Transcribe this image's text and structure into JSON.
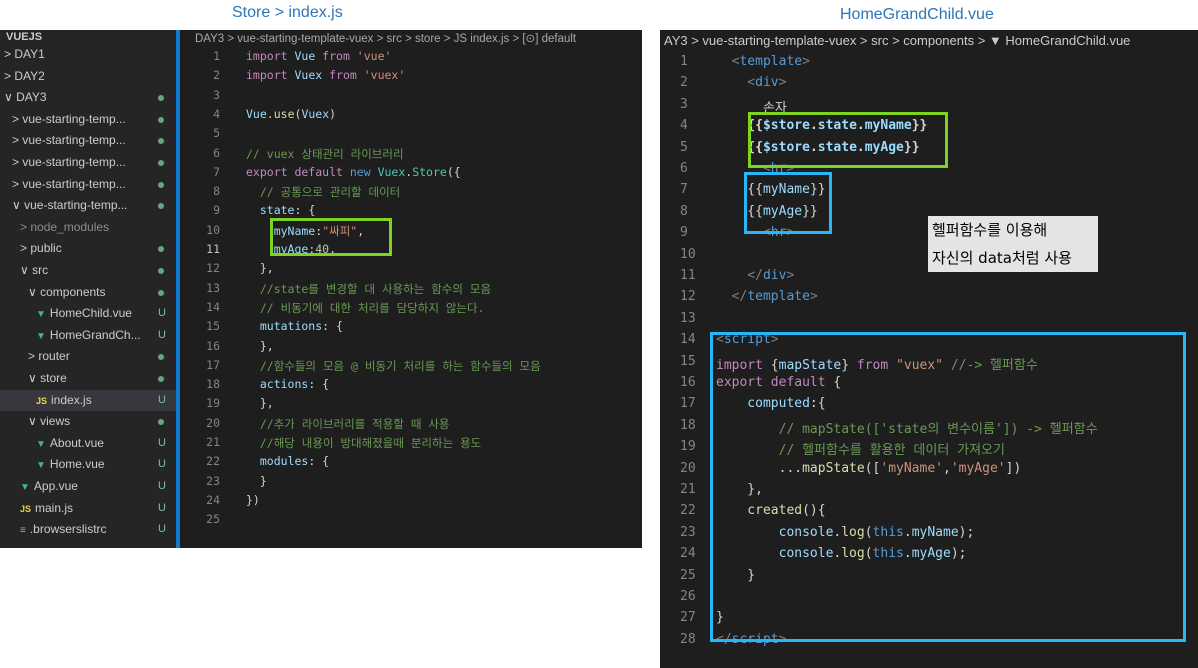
{
  "captions": {
    "left": "Store > index.js",
    "right": "HomeGrandChild.vue"
  },
  "left": {
    "explorer": {
      "root": "VUEJS",
      "items": [
        {
          "label": "DAY1",
          "chev": ">",
          "indent": 0,
          "status": ""
        },
        {
          "label": "DAY2",
          "chev": ">",
          "indent": 0,
          "status": ""
        },
        {
          "label": "DAY3",
          "chev": "∨",
          "indent": 0,
          "status": "dot"
        },
        {
          "label": "vue-starting-temp...",
          "chev": ">",
          "indent": 1,
          "status": "dot"
        },
        {
          "label": "vue-starting-temp...",
          "chev": ">",
          "indent": 1,
          "status": "dot"
        },
        {
          "label": "vue-starting-temp...",
          "chev": ">",
          "indent": 1,
          "status": "dot"
        },
        {
          "label": "vue-starting-temp...",
          "chev": ">",
          "indent": 1,
          "status": "dot"
        },
        {
          "label": "vue-starting-temp...",
          "chev": "∨",
          "indent": 1,
          "status": "dot"
        },
        {
          "label": "node_modules",
          "chev": ">",
          "indent": 2,
          "status": "",
          "muted": true
        },
        {
          "label": "public",
          "chev": ">",
          "indent": 2,
          "status": "dot"
        },
        {
          "label": "src",
          "chev": "∨",
          "indent": 2,
          "status": "dot"
        },
        {
          "label": "components",
          "chev": "∨",
          "indent": 3,
          "status": "dot"
        },
        {
          "label": "HomeChild.vue",
          "icon": "vue",
          "indent": 4,
          "status": "U"
        },
        {
          "label": "HomeGrandCh...",
          "icon": "vue",
          "indent": 4,
          "status": "U"
        },
        {
          "label": "router",
          "chev": ">",
          "indent": 3,
          "status": "dot"
        },
        {
          "label": "store",
          "chev": "∨",
          "indent": 3,
          "status": "dot"
        },
        {
          "label": "index.js",
          "icon": "js",
          "indent": 4,
          "status": "U",
          "selected": true
        },
        {
          "label": "views",
          "chev": "∨",
          "indent": 3,
          "status": "dot"
        },
        {
          "label": "About.vue",
          "icon": "vue",
          "indent": 4,
          "status": "U"
        },
        {
          "label": "Home.vue",
          "icon": "vue",
          "indent": 4,
          "status": "U"
        },
        {
          "label": "App.vue",
          "icon": "vue",
          "indent": 2,
          "status": "U"
        },
        {
          "label": "main.js",
          "icon": "js",
          "indent": 2,
          "status": "U"
        },
        {
          "label": ".browserslistrc",
          "icon": "git",
          "indent": 2,
          "status": "U"
        }
      ]
    },
    "breadcrumb": "DAY3 > vue-starting-template-vuex > src > store > JS index.js > [⊙] default",
    "lines": [
      [
        [
          "k-kw",
          "import "
        ],
        [
          "k-var",
          "Vue"
        ],
        [
          "k-kw",
          " from "
        ],
        [
          "k-str",
          "'vue'"
        ]
      ],
      [
        [
          "k-kw",
          "import "
        ],
        [
          "k-var",
          "Vuex"
        ],
        [
          "k-kw",
          " from "
        ],
        [
          "k-str",
          "'vuex'"
        ]
      ],
      [],
      [
        [
          "k-var",
          "Vue"
        ],
        [
          "k-txt",
          "."
        ],
        [
          "k-fn",
          "use"
        ],
        [
          "k-txt",
          "("
        ],
        [
          "k-var",
          "Vuex"
        ],
        [
          "k-txt",
          ")"
        ]
      ],
      [],
      [
        [
          "k-cmt",
          "// vuex 상태관리 라이브러리"
        ]
      ],
      [
        [
          "k-kw",
          "export default "
        ],
        [
          "k-blue",
          "new "
        ],
        [
          "k-cls",
          "Vuex"
        ],
        [
          "k-txt",
          "."
        ],
        [
          "k-cls",
          "Store"
        ],
        [
          "k-txt",
          "({"
        ]
      ],
      [
        [
          "k-cmt",
          "  // 공통으로 관리할 데이터"
        ]
      ],
      [
        [
          "k-var",
          "  state"
        ],
        [
          "k-txt",
          ": {"
        ]
      ],
      [
        [
          "k-var",
          "    myName"
        ],
        [
          "k-txt",
          ":"
        ],
        [
          "k-str",
          "\"싸피\""
        ],
        [
          "k-txt",
          ","
        ]
      ],
      [
        [
          "k-var",
          "    myAge"
        ],
        [
          "k-txt",
          ":"
        ],
        [
          "k-num",
          "40"
        ],
        [
          "k-txt",
          ","
        ]
      ],
      [
        [
          "k-txt",
          "  },"
        ]
      ],
      [
        [
          "k-cmt",
          "  //state를 변경할 대 사용하는 함수의 모음"
        ]
      ],
      [
        [
          "k-cmt",
          "  // 비동기에 대한 처리를 담당하지 않는다."
        ]
      ],
      [
        [
          "k-var",
          "  mutations"
        ],
        [
          "k-txt",
          ": {"
        ]
      ],
      [
        [
          "k-txt",
          "  },"
        ]
      ],
      [
        [
          "k-cmt",
          "  //함수들의 모음 @ 비동기 처리를 하는 함수들의 모음"
        ]
      ],
      [
        [
          "k-var",
          "  actions"
        ],
        [
          "k-txt",
          ": {"
        ]
      ],
      [
        [
          "k-txt",
          "  },"
        ]
      ],
      [
        [
          "k-cmt",
          "  //추가 라이브러리를 적용할 때 사용"
        ]
      ],
      [
        [
          "k-cmt",
          "  //해당 내용이 방대해졌을때 분리하는 용도"
        ]
      ],
      [
        [
          "k-var",
          "  modules"
        ],
        [
          "k-txt",
          ": {"
        ]
      ],
      [
        [
          "k-txt",
          "  }"
        ]
      ],
      [
        [
          "k-txt",
          "})"
        ]
      ],
      []
    ],
    "current_line": 11
  },
  "right": {
    "breadcrumb": "AY3 > vue-starting-template-vuex > src > components > ▼ HomeGrandChild.vue",
    "lines": [
      [
        [
          "k-gray",
          "  <"
        ],
        [
          "k-tag",
          "template"
        ],
        [
          "k-gray",
          ">"
        ]
      ],
      [
        [
          "k-gray",
          "    <"
        ],
        [
          "k-tag",
          "div"
        ],
        [
          "k-gray",
          ">"
        ]
      ],
      [
        [
          "k-txt",
          "      손자"
        ]
      ],
      [
        [
          "k-txt bold",
          "    {{"
        ],
        [
          "k-var bold",
          "$store"
        ],
        [
          "k-txt bold",
          "."
        ],
        [
          "k-var bold",
          "state"
        ],
        [
          "k-txt bold",
          "."
        ],
        [
          "k-var bold",
          "myName"
        ],
        [
          "k-txt bold",
          "}}"
        ]
      ],
      [
        [
          "k-txt bold",
          "    {{"
        ],
        [
          "k-var bold",
          "$store"
        ],
        [
          "k-txt bold",
          "."
        ],
        [
          "k-var bold",
          "state"
        ],
        [
          "k-txt bold",
          "."
        ],
        [
          "k-var bold",
          "myAge"
        ],
        [
          "k-txt bold",
          "}}"
        ]
      ],
      [
        [
          "k-gray",
          "      <"
        ],
        [
          "k-tag",
          "hr"
        ],
        [
          "k-gray",
          ">"
        ]
      ],
      [
        [
          "k-txt",
          "    {{"
        ],
        [
          "k-var",
          "myName"
        ],
        [
          "k-txt",
          "}}"
        ]
      ],
      [
        [
          "k-txt",
          "    {{"
        ],
        [
          "k-var",
          "myAge"
        ],
        [
          "k-txt",
          "}}"
        ]
      ],
      [
        [
          "k-gray",
          "      <"
        ],
        [
          "k-tag",
          "hr"
        ],
        [
          "k-gray",
          ">"
        ]
      ],
      [],
      [
        [
          "k-gray",
          "    </"
        ],
        [
          "k-tag",
          "div"
        ],
        [
          "k-gray",
          ">"
        ]
      ],
      [
        [
          "k-gray",
          "  </"
        ],
        [
          "k-tag",
          "template"
        ],
        [
          "k-gray",
          ">"
        ]
      ],
      [],
      [
        [
          "k-gray",
          "<"
        ],
        [
          "k-tag",
          "script"
        ],
        [
          "k-gray",
          ">"
        ]
      ],
      [
        [
          "k-kw",
          "import "
        ],
        [
          "k-txt",
          "{"
        ],
        [
          "k-var",
          "mapState"
        ],
        [
          "k-txt",
          "} "
        ],
        [
          "k-kw",
          "from "
        ],
        [
          "k-str",
          "\"vuex\" "
        ],
        [
          "k-cmt",
          "//-> 헬퍼함수"
        ]
      ],
      [
        [
          "k-kw",
          "export default "
        ],
        [
          "k-txt",
          "{"
        ]
      ],
      [
        [
          "k-var",
          "    computed"
        ],
        [
          "k-txt",
          ":{"
        ]
      ],
      [
        [
          "k-cmt",
          "        // mapState(['state의 변수이름']) -> 헬퍼함수"
        ]
      ],
      [
        [
          "k-cmt",
          "        // 헬퍼함수를 활용한 데이터 가져오기"
        ]
      ],
      [
        [
          "k-txt",
          "        ..."
        ],
        [
          "k-fn",
          "mapState"
        ],
        [
          "k-txt",
          "(["
        ],
        [
          "k-str",
          "'myName'"
        ],
        [
          "k-txt",
          ","
        ],
        [
          "k-str",
          "'myAge'"
        ],
        [
          "k-txt",
          "])"
        ]
      ],
      [
        [
          "k-txt",
          "    },"
        ]
      ],
      [
        [
          "k-fn",
          "    created"
        ],
        [
          "k-txt",
          "(){"
        ]
      ],
      [
        [
          "k-var",
          "        console"
        ],
        [
          "k-txt",
          "."
        ],
        [
          "k-fn",
          "log"
        ],
        [
          "k-txt",
          "("
        ],
        [
          "k-blue",
          "this"
        ],
        [
          "k-txt",
          "."
        ],
        [
          "k-var",
          "myName"
        ],
        [
          "k-txt",
          ");"
        ]
      ],
      [
        [
          "k-var",
          "        console"
        ],
        [
          "k-txt",
          "."
        ],
        [
          "k-fn",
          "log"
        ],
        [
          "k-txt",
          "("
        ],
        [
          "k-blue",
          "this"
        ],
        [
          "k-txt",
          "."
        ],
        [
          "k-var",
          "myAge"
        ],
        [
          "k-txt",
          ");"
        ]
      ],
      [
        [
          "k-txt",
          "    }"
        ]
      ],
      [],
      [
        [
          "k-txt",
          "}"
        ]
      ],
      [
        [
          "k-gray",
          "</"
        ],
        [
          "k-tag",
          "script"
        ],
        [
          "k-gray",
          ">"
        ]
      ]
    ],
    "note_lines": [
      "헬퍼함수를 이용해",
      "자신의 data처럼 사용"
    ]
  }
}
